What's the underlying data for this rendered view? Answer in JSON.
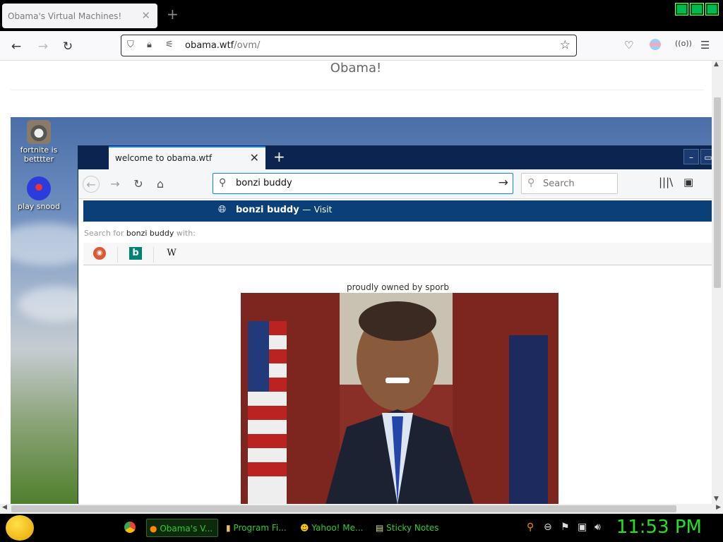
{
  "outer_browser": {
    "tab_title": "Obama's Virtual Machines!",
    "url_host": "obama.wtf",
    "url_path": "/ovm/",
    "page_title": "Obama!"
  },
  "vm": {
    "desktop_icons": [
      {
        "label": "fortnite is betttter",
        "icon": "raccoon-icon"
      },
      {
        "label": "play snood",
        "icon": "snood-icon"
      }
    ],
    "inner_browser": {
      "tab_title": "welcome to obama.wtf",
      "url_value": "bonzi buddy",
      "search_placeholder": "Search",
      "suggestion_text": "bonzi buddy",
      "suggestion_dash": "—",
      "suggestion_action": "Visit",
      "search_with_prefix": "Search for",
      "search_with_term": "bonzi buddy",
      "search_with_suffix": "with:",
      "engines": [
        "duckduckgo-icon",
        "bing-icon",
        "wikipedia-icon"
      ],
      "page_text": "proudly owned by sporb"
    }
  },
  "taskbar": {
    "items": [
      {
        "label": "Obama's V...",
        "icon": "firefox-icon"
      },
      {
        "label": "Program Fi...",
        "icon": "folder-icon"
      },
      {
        "label": "Yahoo! Me...",
        "icon": "smiley-icon"
      },
      {
        "label": "Sticky Notes",
        "icon": "sticky-notes-icon"
      }
    ],
    "clock": "11:53 PM"
  },
  "colors": {
    "clock": "#1ee31e",
    "taskbar_text": "#2ecc2e",
    "inner_tabstrip": "#0c2450",
    "suggestion_bg": "#0a3f78"
  }
}
